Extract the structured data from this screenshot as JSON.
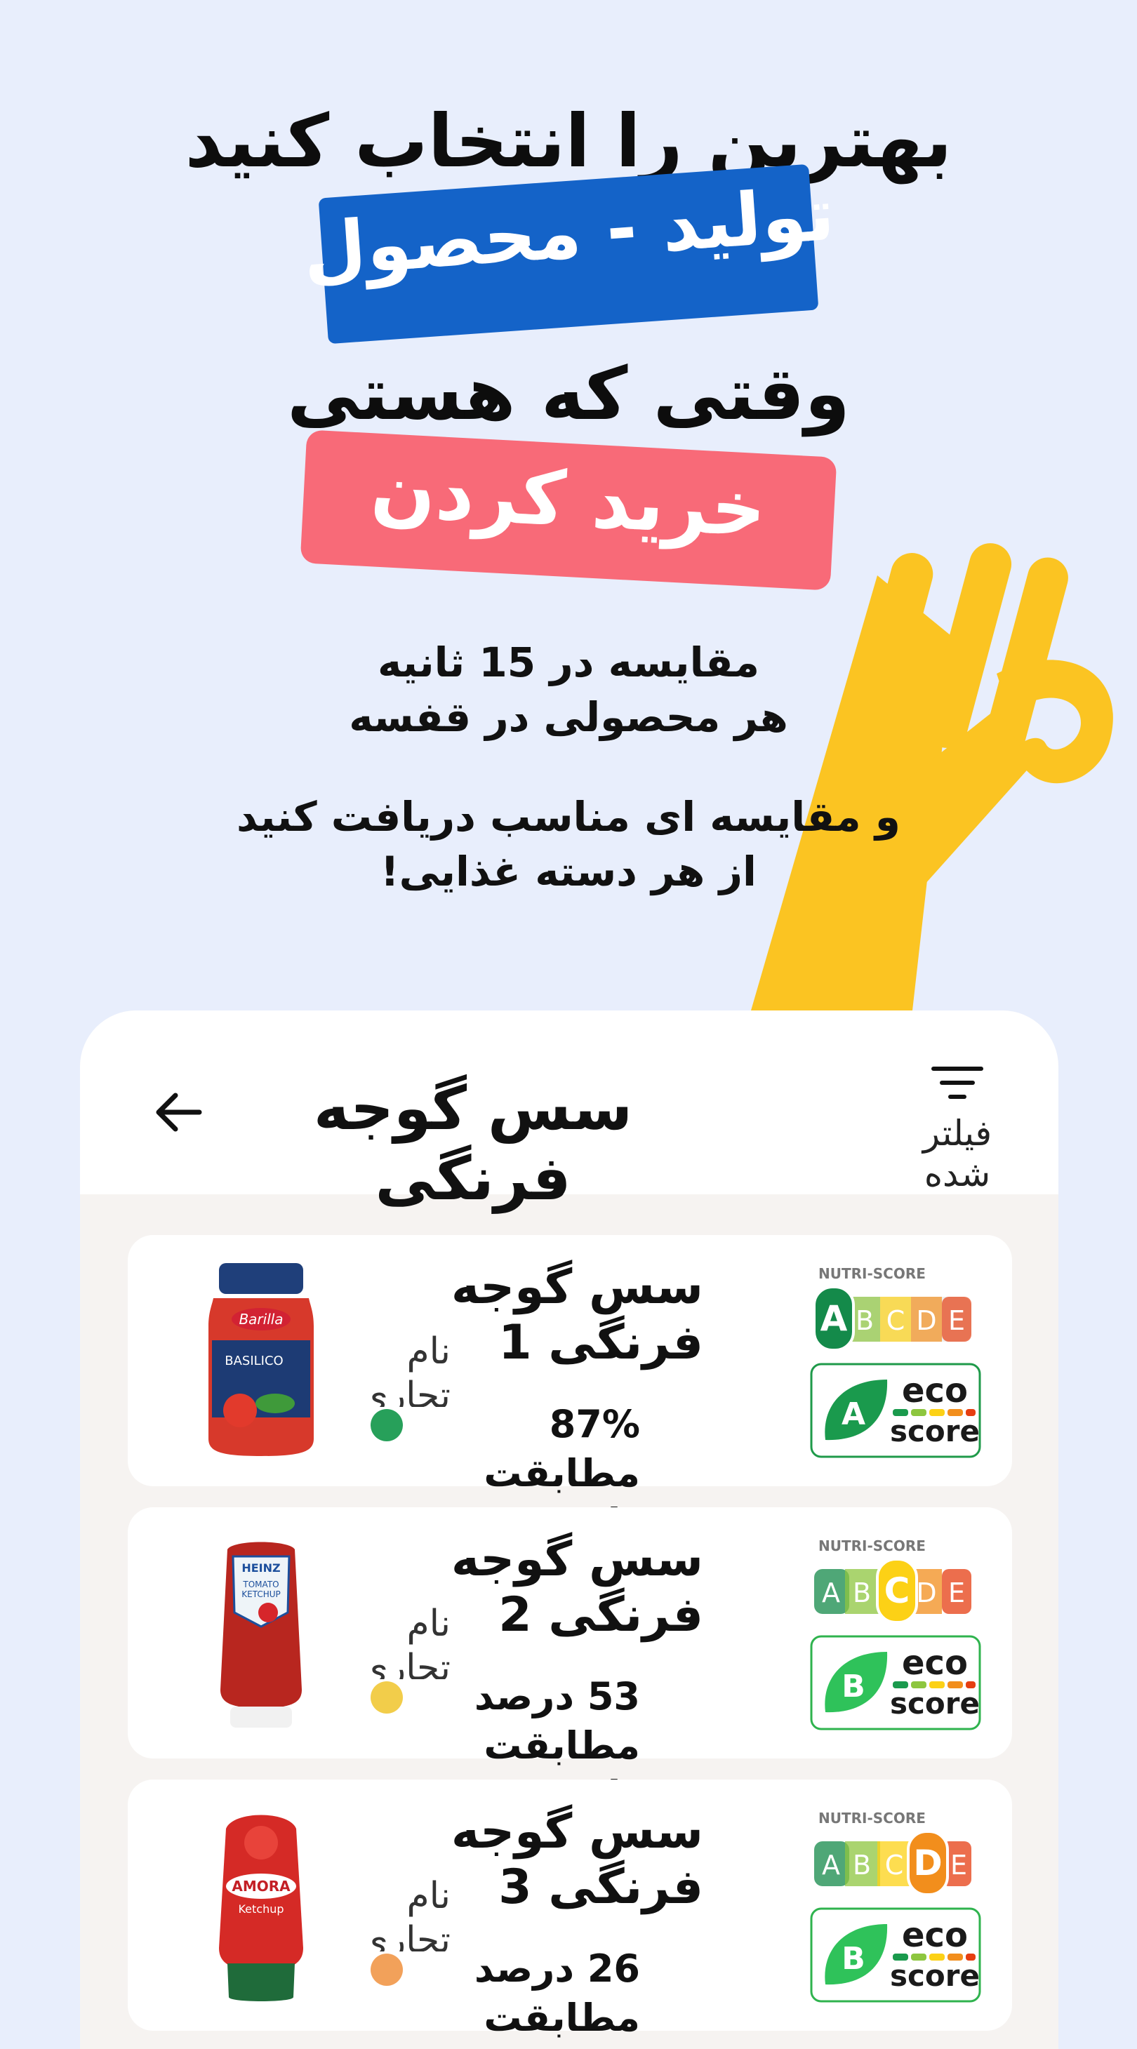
{
  "hero": {
    "line1": "بهترین را انتخاب کنید",
    "line2": "تولید - محصول",
    "line3": "وقتی که هستی",
    "line4": "خرید کردن"
  },
  "subtitle": {
    "line1": "مقایسه در 15 ثانیه",
    "line2": "هر محصولی در قفسه",
    "line3": "و مقایسه ای مناسب دریافت کنید",
    "line4": "از هر دسته غذایی!"
  },
  "screen": {
    "title": "سس گوجه فرنگی",
    "filter_label": "فیلتر شده"
  },
  "products": [
    {
      "title": "سس گوجه فرنگی 1",
      "brand": "نام تجاری",
      "match_value": "87%",
      "match_label": "مطابقت دارد",
      "dot_color": "#27a05a",
      "nutri": "A",
      "eco": "A"
    },
    {
      "title": "سس گوجه فرنگی 2",
      "brand": "نام تجاری",
      "match_value": "53 درصد",
      "match_label": "مطابقت دارد",
      "dot_color": "#f2cd4a",
      "nutri": "C",
      "eco": "B"
    },
    {
      "title": "سس گوجه فرنگی 3",
      "brand": "نام تجاری",
      "match_value": "26 درصد",
      "match_label": "مطابقت دارد",
      "dot_color": "#f2a15a",
      "nutri": "D",
      "eco": "B"
    }
  ],
  "nutri_label": "NUTRI-SCORE",
  "eco_label": {
    "line1": "eco",
    "line2": "score"
  },
  "colors": {
    "blue_banner": "#1463c8",
    "red_banner": "#f86a78",
    "hand": "#fbc422",
    "background": "#e8eefc"
  }
}
